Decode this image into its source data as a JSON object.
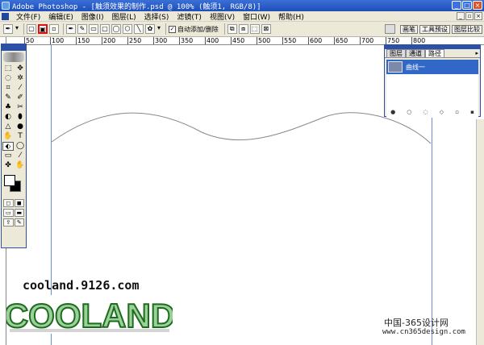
{
  "window": {
    "title": "Adobe Photoshop - [触须效果的制作.psd @ 100% (触须1, RGB/8)]",
    "min": "_",
    "max": "□",
    "close": "×"
  },
  "menu": {
    "items": [
      "文件(F)",
      "编辑(E)",
      "图像(I)",
      "图层(L)",
      "选择(S)",
      "滤镜(T)",
      "视图(V)",
      "窗口(W)",
      "帮助(H)"
    ]
  },
  "options": {
    "auto_add_delete_label": "自动添加/删除",
    "wells": [
      "画笔",
      "工具预设",
      "图层比较"
    ]
  },
  "ruler": {
    "labels": [
      "50",
      "100",
      "150",
      "200",
      "250",
      "300",
      "350",
      "400",
      "450",
      "500",
      "550",
      "600",
      "650",
      "700",
      "750",
      "800"
    ]
  },
  "tools": {
    "glyphs": [
      "⬚",
      "✥",
      "◌",
      "✲",
      "⌗",
      "⁄",
      "✎",
      "✐",
      "♣",
      "✂",
      "◐",
      "⬮",
      "△",
      "●",
      "✋",
      "T",
      "⬖",
      "◯",
      "▭",
      "⁄",
      "✤",
      "✋"
    ]
  },
  "paths_panel": {
    "tabs": [
      "图层",
      "通道",
      "路径"
    ],
    "active_tab": "路径",
    "path_name": "曲线一",
    "menu_glyph": "▸"
  },
  "watermark": {
    "url": "cooland.9126.com",
    "logo_text": "COOLAND"
  },
  "credit": {
    "cn": "中国-365设计网",
    "url": "www.cn365design.com"
  },
  "colors": {
    "title_blue": "#1f4fb8",
    "panel_gray": "#ece9d8",
    "guide_blue": "#6a8ed8",
    "logo_green": "#2e8b2e"
  }
}
